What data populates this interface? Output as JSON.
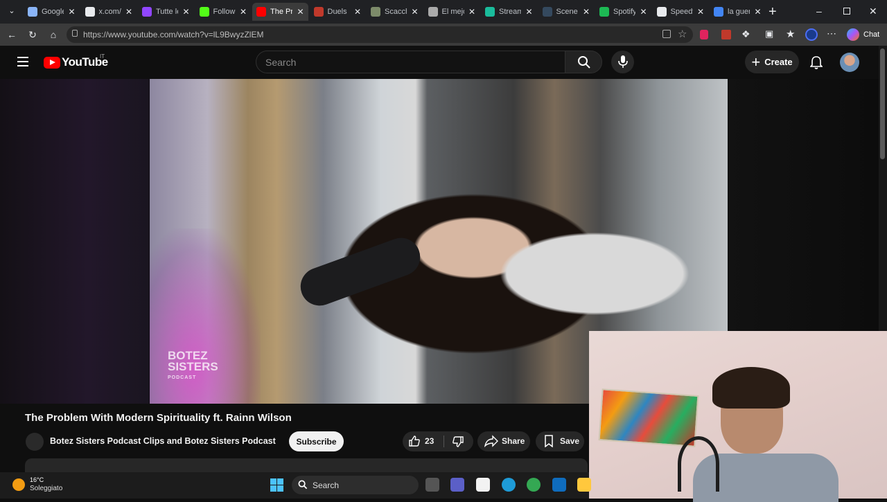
{
  "browser": {
    "tabs": [
      {
        "title": "Google",
        "color": "#8ab4f8"
      },
      {
        "title": "x.com/",
        "color": "#e8eaed"
      },
      {
        "title": "Tutte le",
        "color": "#9146ff"
      },
      {
        "title": "Followin",
        "color": "#53fc18"
      },
      {
        "title": "The Pro",
        "color": "#ff0000",
        "active": true
      },
      {
        "title": "Duels",
        "color": "#c0392b"
      },
      {
        "title": "Scacchi",
        "color": "#7d8b6a"
      },
      {
        "title": "El mejo",
        "color": "#aaaaaa"
      },
      {
        "title": "Stream",
        "color": "#1abc9c"
      },
      {
        "title": "Scene E",
        "color": "#34495e"
      },
      {
        "title": "Spotify",
        "color": "#1db954"
      },
      {
        "title": "Speedt",
        "color": "#e8eaed"
      },
      {
        "title": "la guer",
        "color": "#4285f4"
      }
    ],
    "new_tab_label": "+",
    "url": "https://www.youtube.com/watch?v=lL9BwyzZlEM",
    "chat_label": "Chat"
  },
  "youtube": {
    "logo_text": "YouTube",
    "country_code": "IT",
    "search_placeholder": "Search",
    "create_label": "Create",
    "video_title": "The Problem With Modern Spirituality ft. Rainn Wilson",
    "channel_name": "Botez Sisters Podcast Clips and Botez Sisters Podcast",
    "subscribe_label": "Subscribe",
    "like_count": "23",
    "share_label": "Share",
    "save_label": "Save",
    "watermark_line1": "BOTEZ",
    "watermark_line2": "SISTERS",
    "watermark_line3": "PODCAST"
  },
  "taskbar": {
    "temperature": "16°C",
    "weather": "Soleggiato",
    "search_label": "Search",
    "apps": [
      {
        "name": "file-explorer-icon",
        "color": "#555"
      },
      {
        "name": "teams-icon",
        "color": "#5b5fc7"
      },
      {
        "name": "store-icon",
        "color": "#f2f2f2"
      },
      {
        "name": "edge-icon",
        "color": "#1e9bd7"
      },
      {
        "name": "chrome-icon",
        "color": "#34a853"
      },
      {
        "name": "outlook-icon",
        "color": "#0f6cbd"
      },
      {
        "name": "folder-icon",
        "color": "#ffc83d"
      }
    ]
  }
}
